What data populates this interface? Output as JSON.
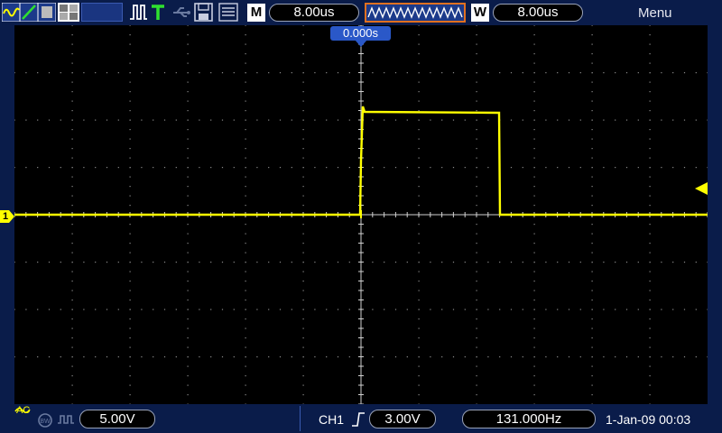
{
  "top": {
    "timebase_label": "M",
    "timebase_value": "8.00us",
    "window_label": "W",
    "window_value": "8.00us",
    "menu_label": "Menu"
  },
  "screen": {
    "trigger_position": "0.000s",
    "channel_marker": "1",
    "trace_color": "#ffff00"
  },
  "bottom": {
    "coupling_label": "AC",
    "volts_div": "5.00V",
    "trigger_source": "CH1",
    "trigger_level": "3.00V",
    "frequency": "131.000Hz",
    "datetime": "1-Jan-09 00:03"
  },
  "colors": {
    "bar_bg": "#0a1c4a",
    "trace": "#ffff00",
    "accent_blue": "#2a58c8",
    "trigger_orange": "#e07020"
  }
}
